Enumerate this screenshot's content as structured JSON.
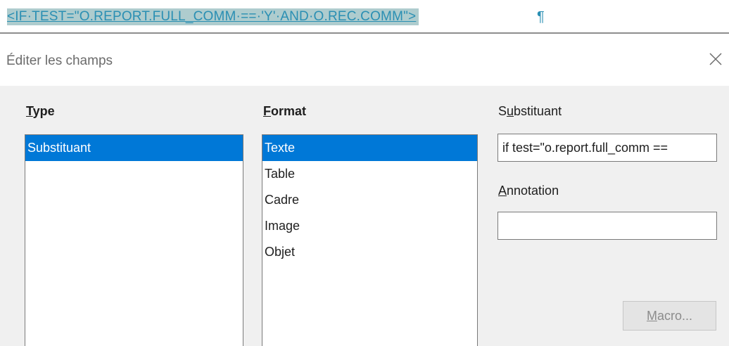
{
  "document": {
    "field_text": "<IF·TEST=\"O.REPORT.FULL_COMM·==·'Y'·AND·O.REC.COMM\">",
    "pilcrow": "¶"
  },
  "dialog": {
    "title": "Éditer les champs",
    "close_icon": "close-icon"
  },
  "type_section": {
    "label_first": "T",
    "label_rest": "ype",
    "items": [
      "Substituant"
    ],
    "selected_index": 0
  },
  "format_section": {
    "label_first": "F",
    "label_rest": "ormat",
    "items": [
      "Texte",
      "Table",
      "Cadre",
      "Image",
      "Objet"
    ],
    "selected_index": 0
  },
  "substituant": {
    "label_pre": "S",
    "label_u": "u",
    "label_post": "bstituant",
    "value": "if test=\"o.report.full_comm =="
  },
  "annotation": {
    "label_first": "A",
    "label_rest": "nnotation",
    "value": ""
  },
  "macro_button": {
    "label_first": "M",
    "label_rest": "acro..."
  },
  "colors": {
    "selection": "#0078d7",
    "field_highlight": "#aeccce",
    "field_text": "#2a8fb3"
  }
}
